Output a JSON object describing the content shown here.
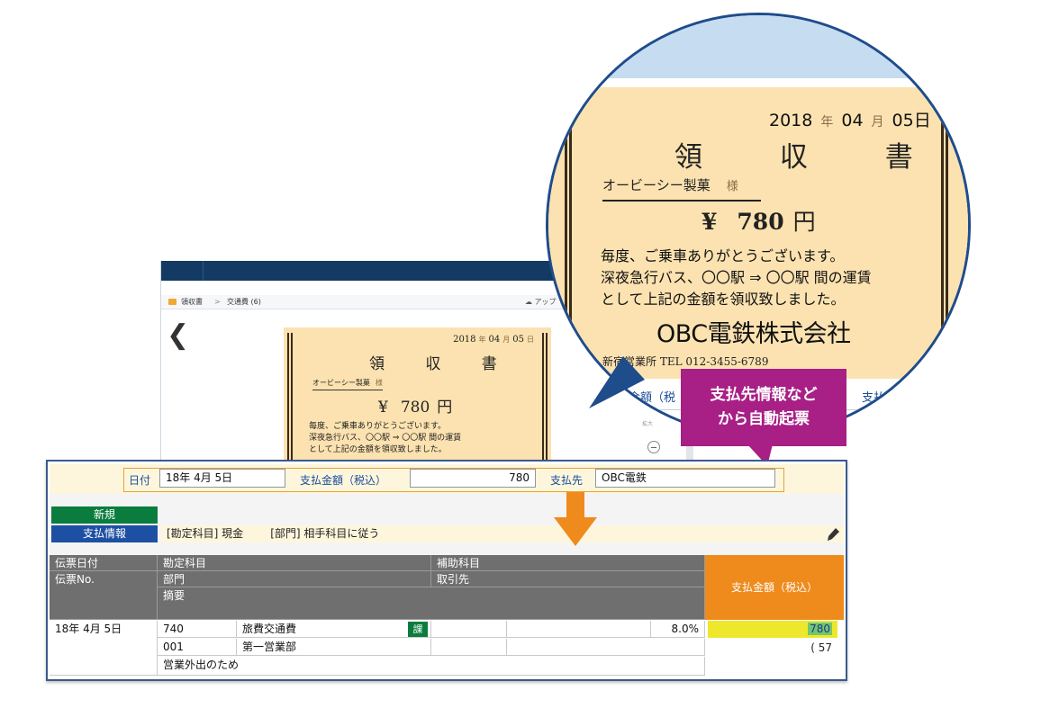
{
  "app": {
    "breadcrumb": [
      "領収書",
      "交通費 (6)"
    ],
    "breadcrumb_separator": ">",
    "upload_label": "アップ",
    "back_glyph": "❮",
    "zoom_label": "拡大"
  },
  "receipt": {
    "year": "2018",
    "year_unit": "年",
    "month": "04",
    "month_unit": "月",
    "day": "05",
    "day_unit": "日",
    "day_cut": "日",
    "title": "領 収 書",
    "customer": "オービーシー製菓",
    "honorific": "様",
    "yen_sign": "¥",
    "amount": "780",
    "amount_unit": "円",
    "message_lines": [
      "毎度、ご乗車ありがとうございます。",
      "深夜急行バス、〇〇駅 ⇒ 〇〇駅 間の運賃",
      "として上記の金額を領収致しました。"
    ],
    "company": "OBC電鉄株式会社",
    "branch": "新宿営業所 TEL 012-3455-6789"
  },
  "magnifier_fields": {
    "amount_label": "支払金額（税",
    "payee_label": "支払先"
  },
  "callout": {
    "line1": "支払先情報など",
    "line2": "から自動起票"
  },
  "voucher": {
    "date_label": "日付",
    "date_value": "18年 4月 5日",
    "amount_label": "支払金額（税込）",
    "amount_value": "780",
    "payee_label": "支払先",
    "payee_value": "OBC電鉄",
    "new_button": "新規",
    "pay_info_button": "支払情報",
    "pay_info_account": "[勘定科目] 現金",
    "pay_info_dept": "[部門] 相手科目に従う",
    "table": {
      "headers": {
        "voucher_date": "伝票日付",
        "voucher_no": "伝票No.",
        "account": "勘定科目",
        "sub_account": "補助科目",
        "department": "部門",
        "client": "取引先",
        "memo": "摘要",
        "amount": "支払金額（税込）"
      },
      "row": {
        "date": "18年 4月 5日",
        "account_code": "740",
        "account_name": "旅費交通費",
        "tax_badge": "課",
        "tax_rate": "8.0%",
        "amount": "780",
        "dept_code": "001",
        "dept_name": "第一営業部",
        "tax_amount": "( 57",
        "memo": "営業外出のため"
      }
    }
  },
  "colors": {
    "header_navy": "#123a63",
    "receipt_paper": "#fbe2b0",
    "magnifier_border": "#1f4c8b",
    "callout": "#a81f86",
    "arrow": "#ef8b1c",
    "new_button": "#0a7d3e",
    "pay_button": "#1d4fa3",
    "amount_highlight": "#eee82c"
  }
}
